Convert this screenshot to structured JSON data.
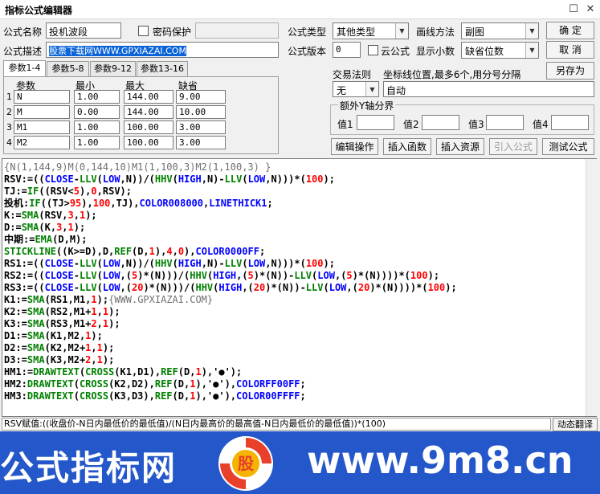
{
  "window": {
    "title": "指标公式编辑器",
    "max_glyph": "☐",
    "close_glyph": "✕"
  },
  "form": {
    "name_label": "公式名称",
    "name_value": "投机波段",
    "password_label": "密码保护",
    "desc_label": "公式描述",
    "desc_value": "股票下载网WWW.GPXIAZAI.COM",
    "type_label": "公式类型",
    "type_value": "其他类型",
    "draw_label": "画线方法",
    "draw_value": "副图",
    "version_label": "公式版本",
    "version_value": "0",
    "cloud_label": "云公式",
    "decimal_label": "显示小数",
    "decimal_value": "缺省位数",
    "trade_label": "交易法则",
    "trade_value": "无",
    "coord_label": "坐标线位置,最多6个,用分号分隔",
    "coord_value": "自动",
    "axis_label": "额外Y轴分界",
    "axis_items": [
      {
        "label": "值1"
      },
      {
        "label": "值2"
      },
      {
        "label": "值3"
      },
      {
        "label": "值4"
      }
    ]
  },
  "buttons": {
    "ok": "确 定",
    "cancel": "取 消",
    "save_as": "另存为",
    "edit_ops": "编辑操作",
    "insert_func": "插入函数",
    "insert_res": "插入资源",
    "import_formula": "引入公式",
    "test_formula": "测试公式"
  },
  "tabs": [
    {
      "label": "参数1-4"
    },
    {
      "label": "参数5-8"
    },
    {
      "label": "参数9-12"
    },
    {
      "label": "参数13-16"
    }
  ],
  "params": {
    "headers": [
      "参数",
      "最小",
      "最大",
      "缺省"
    ],
    "rows": [
      {
        "num": "1",
        "name": "N",
        "min": "1.00",
        "max": "144.00",
        "def": "9.00"
      },
      {
        "num": "2",
        "name": "M",
        "min": "0.00",
        "max": "144.00",
        "def": "10.00"
      },
      {
        "num": "3",
        "name": "M1",
        "min": "1.00",
        "max": "100.00",
        "def": "3.00"
      },
      {
        "num": "4",
        "name": "M2",
        "min": "1.00",
        "max": "100.00",
        "def": "3.00"
      }
    ]
  },
  "code_lines": [
    "{N(1,144,9)M(0,144,10)M1(1,100,3)M2(1,100,3) }",
    "RSV:=((CLOSE-LLV(LOW,N))/(HHV(HIGH,N)-LLV(LOW,N)))*(100);",
    "TJ:=IF((RSV<5),0,RSV);",
    "投机:IF((TJ>95),100,TJ),COLOR008000,LINETHICK1;",
    "K:=SMA(RSV,3,1);",
    "D:=SMA(K,3,1);",
    "中期:=EMA(D,M);",
    "STICKLINE((K>=D),D,REF(D,1),4,0),COLOR0000FF;",
    "RS1:=((CLOSE-LLV(LOW,N))/(HHV(HIGH,N)-LLV(LOW,N)))*(100);",
    "RS2:=((CLOSE-LLV(LOW,(5)*(N)))/(HHV(HIGH,(5)*(N))-LLV(LOW,(5)*(N))))*(100);",
    "RS3:=((CLOSE-LLV(LOW,(20)*(N)))/(HHV(HIGH,(20)*(N))-LLV(LOW,(20)*(N))))*(100);",
    "K1:=SMA(RS1,M1,1);{WWW.GPXIAZAI.COM}",
    "K2:=SMA(RS2,M1+1,1);",
    "K3:=SMA(RS3,M1+2,1);",
    "D1:=SMA(K1,M2,1);",
    "D2:=SMA(K2,M2+1,1);",
    "D3:=SMA(K3,M2+2,1);",
    "HM1:=DRAWTEXT(CROSS(K1,D1),REF(D,1),'●');",
    "HM2:DRAWTEXT(CROSS(K2,D2),REF(D,1),'●'),COLORFF00FF;",
    "HM3:DRAWTEXT(CROSS(K3,D3),REF(D,1),'●'),COLOR00FFFF;"
  ],
  "status": {
    "text": "RSV赋值:((收盘价-N日内最低价的最低值)/(N日内最高价的最高值-N日内最低价的最低值))*(100)",
    "translate": "动态翻译"
  },
  "banner": {
    "left_text": "公式指标网",
    "right_text": "www.9m8.cn",
    "logo_text": "股"
  },
  "colors": {
    "keyword": "#0000ff",
    "function": "#008000",
    "number": "#ff0000",
    "comment": "#707070",
    "text": "#000000",
    "banner_bg": "#2457c9",
    "logo_red": "#e8402a"
  }
}
